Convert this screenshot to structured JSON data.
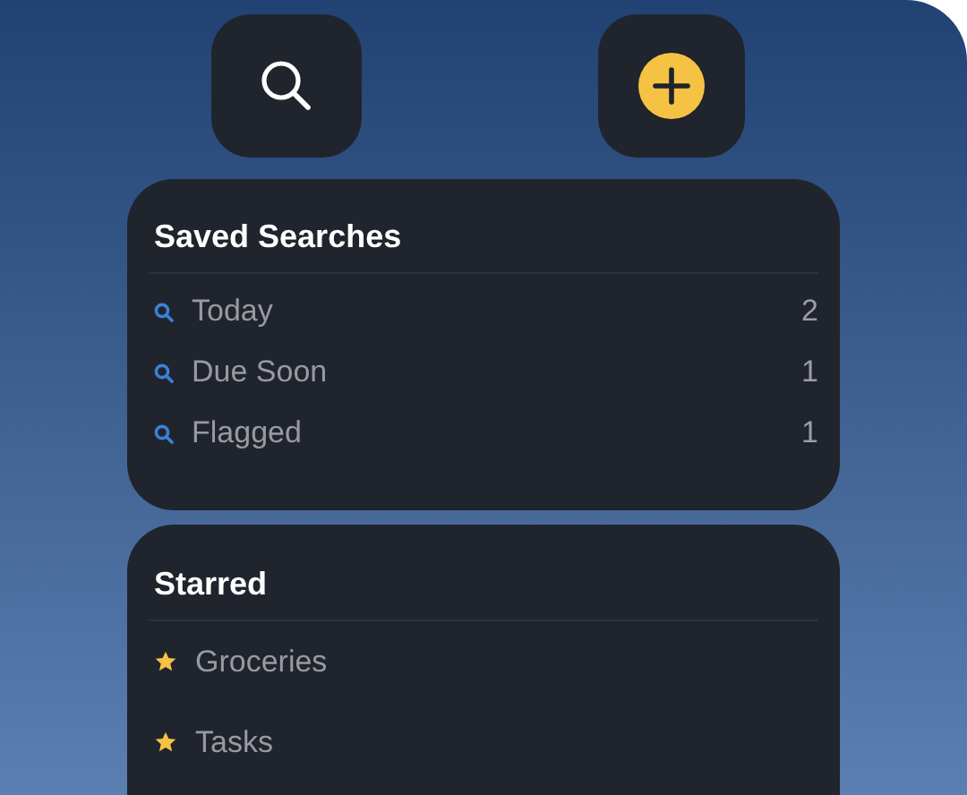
{
  "toolbar": [
    {
      "kind": "search"
    },
    {
      "kind": "add"
    }
  ],
  "sections": [
    {
      "title": "Saved Searches",
      "kind": "searches",
      "items": [
        {
          "label": "Today",
          "count": "2"
        },
        {
          "label": "Due Soon",
          "count": "1"
        },
        {
          "label": "Flagged",
          "count": "1"
        }
      ]
    },
    {
      "title": "Starred",
      "kind": "starred",
      "items": [
        {
          "label": "Groceries"
        },
        {
          "label": "Tasks"
        }
      ]
    }
  ]
}
